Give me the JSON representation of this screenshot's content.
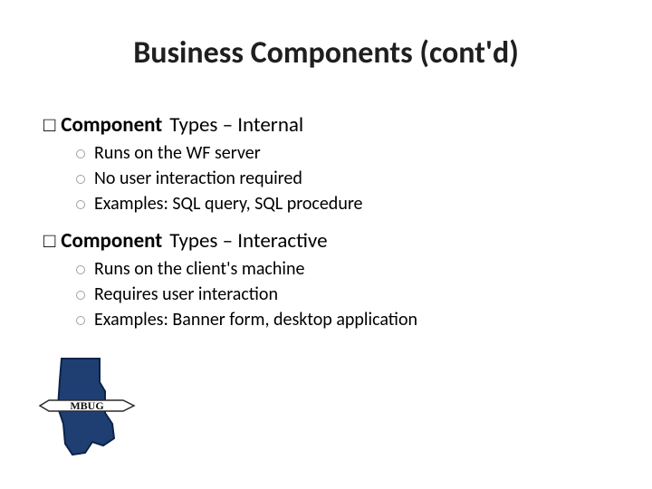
{
  "title": "Business Components (cont'd)",
  "sections": [
    {
      "bullet_glyph": "□",
      "bold": "Component",
      "rest": "Types – Internal",
      "items": [
        "Runs on the WF server",
        "No user interaction required",
        "Examples:  SQL query, SQL procedure"
      ]
    },
    {
      "bullet_glyph": "□",
      "bold": "Component",
      "rest": "Types – Interactive",
      "items": [
        "Runs on the client's machine",
        "Requires user interaction",
        "Examples:  Banner form, desktop application"
      ]
    }
  ],
  "logo": {
    "label": "MBUG"
  }
}
